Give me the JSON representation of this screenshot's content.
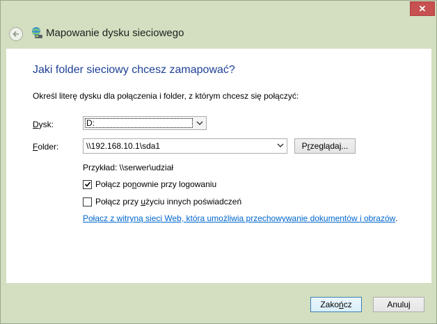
{
  "window": {
    "title": "Mapowanie dysku sieciowego",
    "close_glyph": "✕"
  },
  "main": {
    "heading": "Jaki folder sieciowy chcesz zamapować?",
    "instruction": "Określ literę dysku dla połączenia i folder, z którym chcesz się połączyć:",
    "drive": {
      "label_mnemonic": "D",
      "label_rest": "ysk:",
      "value": "D:"
    },
    "folder": {
      "label_mnemonic": "F",
      "label_rest": "older:",
      "value": "\\\\192.168.10.1\\sda1"
    },
    "browse_button": {
      "label_pre": "P",
      "label_mnemonic": "r",
      "label_post": "zeglądaj..."
    },
    "example": "Przykład: \\\\serwer\\udział",
    "reconnect": {
      "label_pre": "Połącz po",
      "label_mnemonic": "n",
      "label_post": "ownie przy logowaniu",
      "checked": true
    },
    "other_credentials": {
      "label_pre": "Połącz przy ",
      "label_mnemonic": "u",
      "label_post": "życiu innych poświadczeń",
      "checked": false
    },
    "web_link": "Połącz z witryną sieci Web, która umożliwia przechowywanie dokumentów i obrazów",
    "web_link_suffix": "."
  },
  "footer": {
    "finish_button": {
      "label_pre": "Zako",
      "label_mnemonic": "ń",
      "label_post": "cz"
    },
    "cancel_button": "Anuluj"
  },
  "icons": {
    "back": "back-arrow-icon",
    "app": "network-drive-icon",
    "close": "close-icon",
    "dropdown": "chevron-down-icon",
    "checkmark": "checkmark-icon"
  },
  "colors": {
    "heading": "#1c3f95",
    "link": "#0066cc",
    "close_button": "#c75050",
    "frame": "#d3dfc0"
  }
}
